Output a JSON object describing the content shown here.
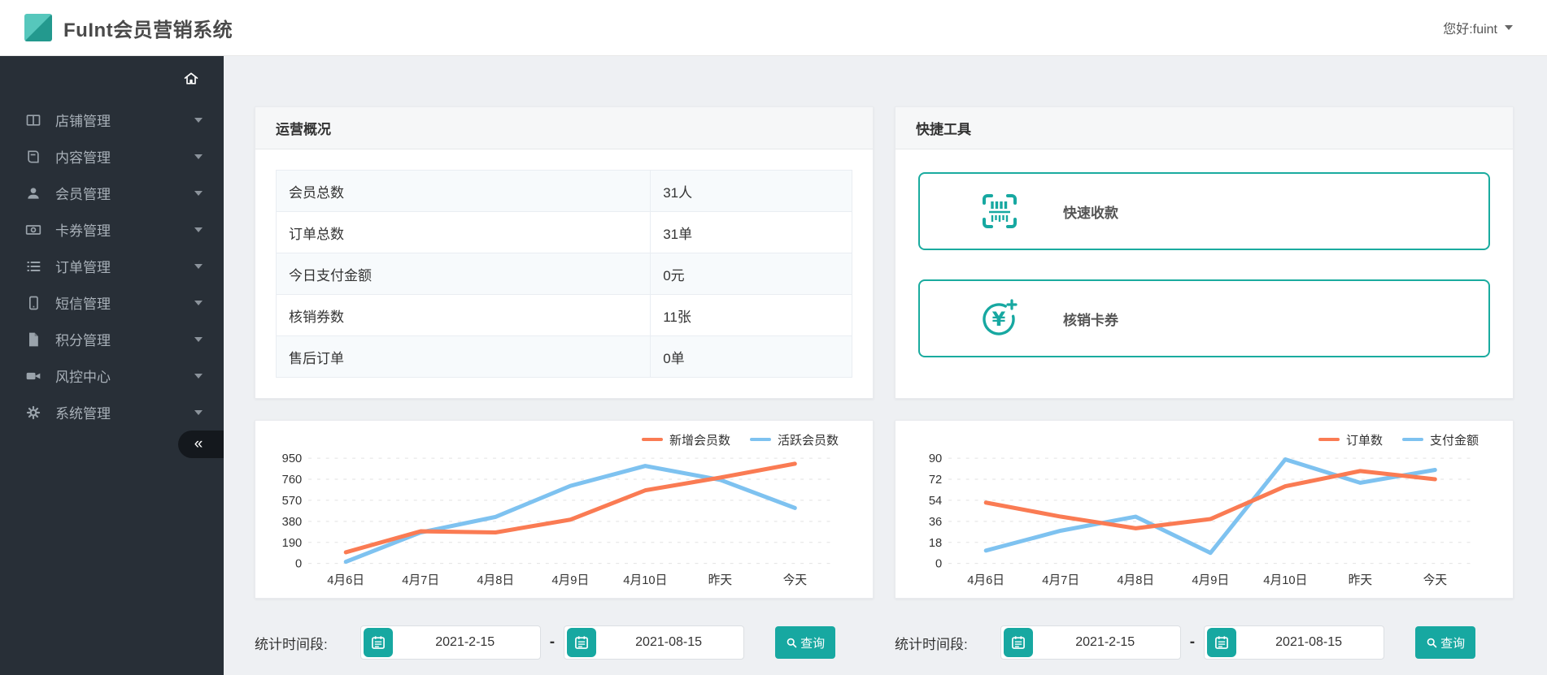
{
  "header": {
    "title": "FuInt会员营销系统",
    "user_greeting": "您好:fuint"
  },
  "sidebar": {
    "items": [
      {
        "label": "店铺管理",
        "icon": "shop-icon"
      },
      {
        "label": "内容管理",
        "icon": "content-icon"
      },
      {
        "label": "会员管理",
        "icon": "member-icon"
      },
      {
        "label": "卡券管理",
        "icon": "coupon-icon"
      },
      {
        "label": "订单管理",
        "icon": "order-icon"
      },
      {
        "label": "短信管理",
        "icon": "sms-icon"
      },
      {
        "label": "积分管理",
        "icon": "points-icon"
      },
      {
        "label": "风控中心",
        "icon": "risk-icon"
      },
      {
        "label": "系统管理",
        "icon": "system-icon"
      }
    ],
    "collapse_glyph": "«"
  },
  "overview": {
    "title": "运营概况",
    "rows": [
      {
        "label": "会员总数",
        "value": "31人"
      },
      {
        "label": "订单总数",
        "value": "31单"
      },
      {
        "label": "今日支付金额",
        "value": "0元"
      },
      {
        "label": "核销券数",
        "value": "11张"
      },
      {
        "label": "售后订单",
        "value": "0单"
      }
    ]
  },
  "tools": {
    "title": "快捷工具",
    "items": [
      {
        "label": "快速收款",
        "icon": "scan-barcode-icon"
      },
      {
        "label": "核销卡券",
        "icon": "yen-plus-icon"
      }
    ]
  },
  "chart_data": [
    {
      "type": "line",
      "x": [
        "4月6日",
        "4月7日",
        "4月8日",
        "4月9日",
        "4月10日",
        "昨天",
        "今天"
      ],
      "series": [
        {
          "name": "新增会员数",
          "color": "#fa7b53",
          "values": [
            100,
            290,
            280,
            395,
            660,
            775,
            900
          ]
        },
        {
          "name": "活跃会员数",
          "color": "#7ec2f0",
          "values": [
            15,
            280,
            420,
            700,
            880,
            755,
            500
          ]
        }
      ],
      "ylim": [
        0,
        950
      ],
      "yticks": [
        0,
        190,
        380,
        570,
        760,
        950
      ],
      "legend_position": "top-right",
      "grid": "dashed-horizontal"
    },
    {
      "type": "line",
      "x": [
        "4月6日",
        "4月7日",
        "4月8日",
        "4月9日",
        "4月10日",
        "昨天",
        "今天"
      ],
      "series": [
        {
          "name": "订单数",
          "color": "#fa7b53",
          "values": [
            52,
            40,
            30,
            38,
            66,
            79,
            72
          ]
        },
        {
          "name": "支付金额",
          "color": "#7ec2f0",
          "values": [
            11,
            28,
            40,
            9,
            89,
            69,
            80
          ]
        }
      ],
      "ylim": [
        0,
        90
      ],
      "yticks": [
        0,
        18,
        36,
        54,
        72,
        90
      ],
      "legend_position": "top-right",
      "grid": "dashed-horizontal"
    }
  ],
  "filters": [
    {
      "label": "统计时间段:",
      "start": "2021-2-15",
      "separator": "-",
      "end": "2021-08-15",
      "search": "查询"
    },
    {
      "label": "统计时间段:",
      "start": "2021-2-15",
      "separator": "-",
      "end": "2021-08-15",
      "search": "查询"
    }
  ],
  "colors": {
    "accent": "#17a8a1",
    "tool_card_border": "#1aab9f",
    "sidebar_bg": "#282f37",
    "line_orange": "#fa7b53",
    "line_blue": "#7ec2f0",
    "main_bg": "#eef0f3"
  }
}
